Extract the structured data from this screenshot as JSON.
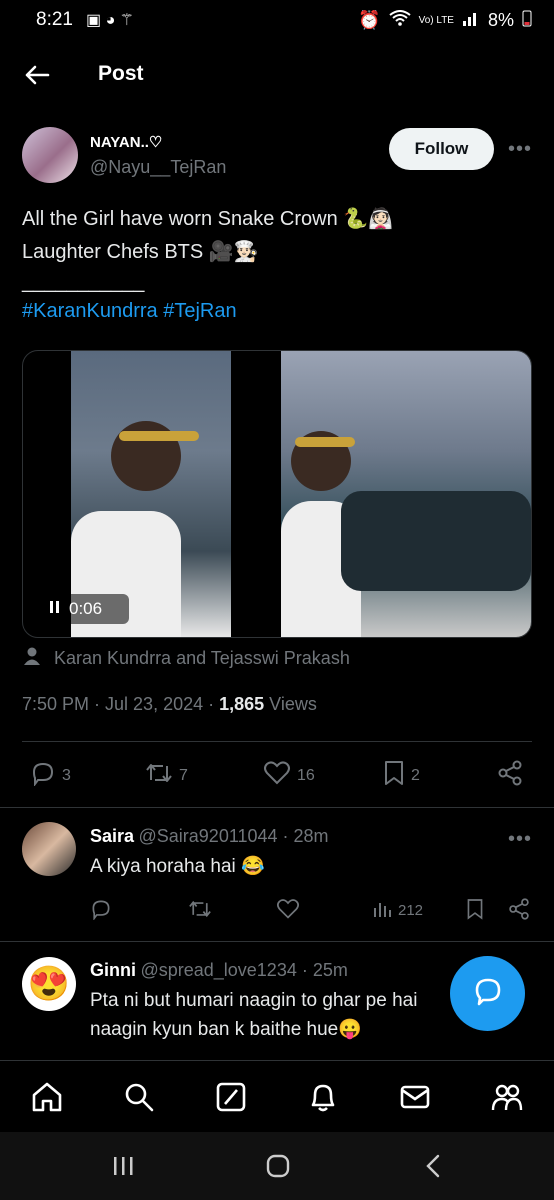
{
  "status_bar": {
    "time": "8:21",
    "battery": "8%",
    "network": "Vo) LTE"
  },
  "header": {
    "title": "Post"
  },
  "post": {
    "author_name": "NAYAN..♡",
    "author_handle": "@Nayu__TejRan",
    "follow_label": "Follow",
    "text_line1": "All the Girl have worn Snake Crown 🐍👰🏻",
    "text_line2": "Laughter Chefs BTS 🎥👨🏻‍🍳",
    "divider_line": "___________",
    "hashtags": "#KaranKundrra #TejRan",
    "video_time": "0:06",
    "tagged": "Karan Kundrra and Tejasswi Prakash",
    "timestamp": "7:50 PM · Jul 23, 2024 · ",
    "views_count": "1,865",
    "views_label": " Views",
    "replies": "3",
    "reposts": "7",
    "likes": "16",
    "bookmarks": "2"
  },
  "replies": [
    {
      "name": "Saira",
      "handle": "@Saira92011044 · 28m",
      "text": "A kiya horaha hai 😂",
      "views": "212"
    },
    {
      "name": "Ginni",
      "handle": "@spread_love1234 · 25m",
      "text_line1": "Pta ni but humari naagin to ghar pe hai",
      "text_line2": "naagin kyun ban k baithe hue😛"
    }
  ],
  "colors": {
    "accent": "#1d9bf0",
    "muted": "#71767b",
    "background": "#000000"
  },
  "icons": [
    "back-arrow-icon",
    "more-icon",
    "play-pause-icon",
    "person-icon",
    "reply-icon",
    "repost-icon",
    "like-icon",
    "bookmark-icon",
    "share-icon",
    "views-icon",
    "chat-compose-icon",
    "home-icon",
    "search-icon",
    "grok-icon",
    "notifications-icon",
    "messages-icon",
    "communities-icon"
  ]
}
